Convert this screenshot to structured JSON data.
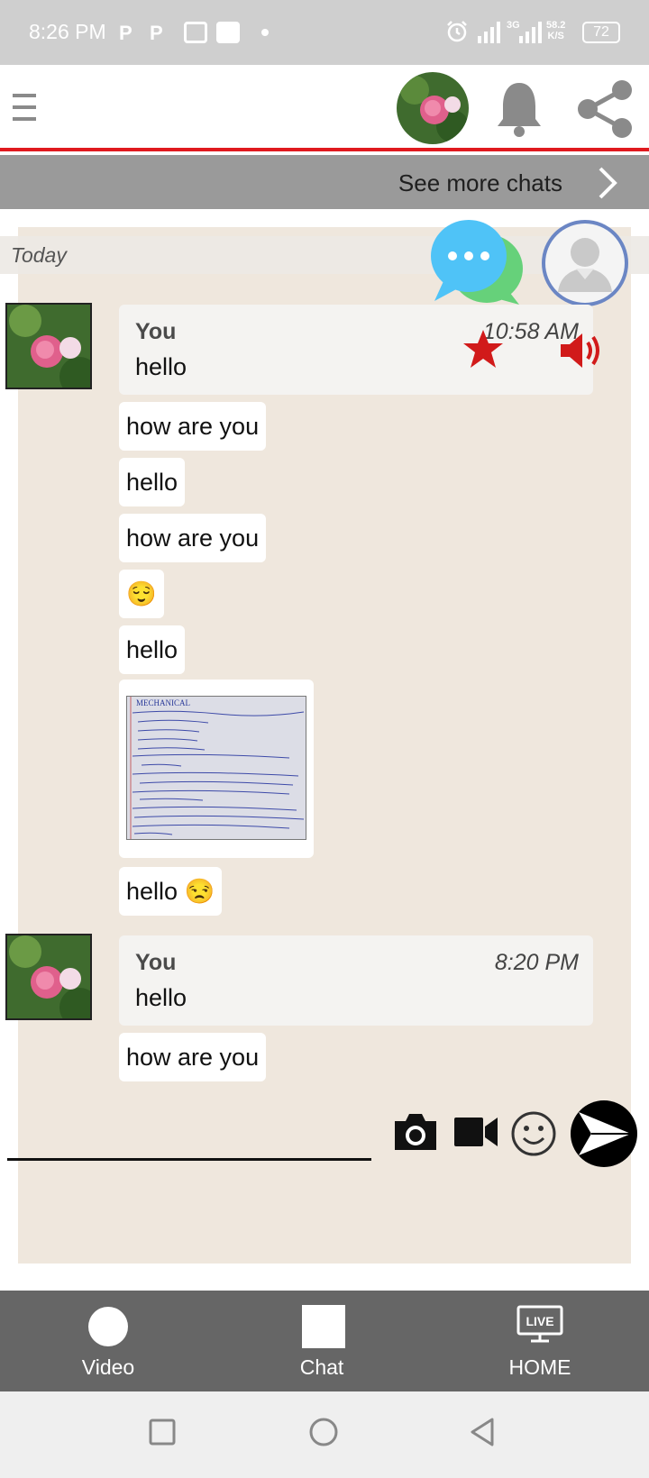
{
  "status_bar": {
    "time": "8:26 PM",
    "network_type": "3G",
    "speed_value": "58.2",
    "speed_unit": "K/S",
    "battery": "72"
  },
  "header": {
    "menu_icon": "hamburger-icon",
    "notification_icon": "bell-icon",
    "share_icon": "share-icon"
  },
  "see_more": {
    "label": "See more chats"
  },
  "chat": {
    "date_divider": "Today",
    "groups": [
      {
        "sender": "You",
        "time": "10:58 AM",
        "first_message": "hello",
        "messages": [
          "how are you",
          "hello",
          "how are you",
          "😌",
          "hello"
        ],
        "image_caption": "MECHANICAL",
        "after_image": "hello 😒"
      },
      {
        "sender": "You",
        "time": "8:20 PM",
        "first_message": "hello",
        "messages": [
          "how are you"
        ]
      }
    ]
  },
  "composer": {
    "placeholder": "",
    "camera_icon": "camera-icon",
    "video_icon": "video-camera-icon",
    "emoji_icon": "emoji-icon",
    "send_icon": "send-icon"
  },
  "bottom_nav": {
    "video_label": "Video",
    "chat_label": "Chat",
    "home_label": "HOME",
    "live_badge": "LIVE"
  },
  "colors": {
    "accent_red": "#e0191e",
    "nav_gray": "#666666",
    "chat_background": "#efe7dd",
    "fab_blue": "#4fc3f7",
    "fab_green": "#66d17a"
  }
}
